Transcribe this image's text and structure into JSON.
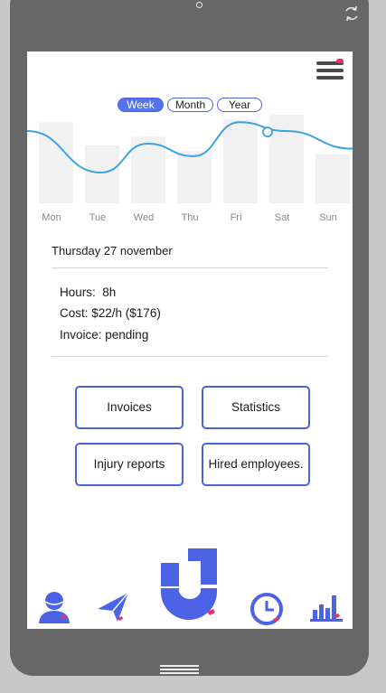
{
  "range_tabs": [
    {
      "label": "Week",
      "active": true
    },
    {
      "label": "Month",
      "active": false
    },
    {
      "label": "Year",
      "active": false
    }
  ],
  "chart_data": {
    "type": "line",
    "categories": [
      "Mon",
      "Tue",
      "Wed",
      "Thu",
      "Fri",
      "Sat",
      "Sun"
    ],
    "note_values_unlabeled": true,
    "values": [
      5.6,
      2.3,
      4.6,
      3.6,
      6.3,
      5.6,
      4.2
    ],
    "background_bars": [
      5.6,
      4.0,
      4.6,
      3.6,
      5.8,
      6.4,
      3.4
    ],
    "highlighted_index": 5,
    "ylim": [
      0,
      10
    ],
    "colors": {
      "line": "#3aa4e1",
      "bars": "#f1f1f1",
      "marker": "#3aa4e1"
    }
  },
  "selected_day": {
    "date": "Thursday 27 november",
    "hours_line": "Hours:  8h",
    "cost_line": "Cost: $22/h ($176)",
    "invoice_line": "Invoice: pending"
  },
  "actions": {
    "invoices": "Invoices",
    "statistics": "Statistics",
    "injury_reports": "Injury reports",
    "hired_employees": "Hired employees."
  },
  "bottom_nav": [
    {
      "icon": "profile-icon"
    },
    {
      "icon": "send-icon"
    },
    {
      "icon": "magnet-icon"
    },
    {
      "icon": "clock-icon"
    },
    {
      "icon": "bar-chart-icon"
    }
  ],
  "colors": {
    "accent": "#4b63e0",
    "nav_blue": "#4d63e6",
    "badge_pink": "#e8336a",
    "phone_frame": "#676767"
  }
}
